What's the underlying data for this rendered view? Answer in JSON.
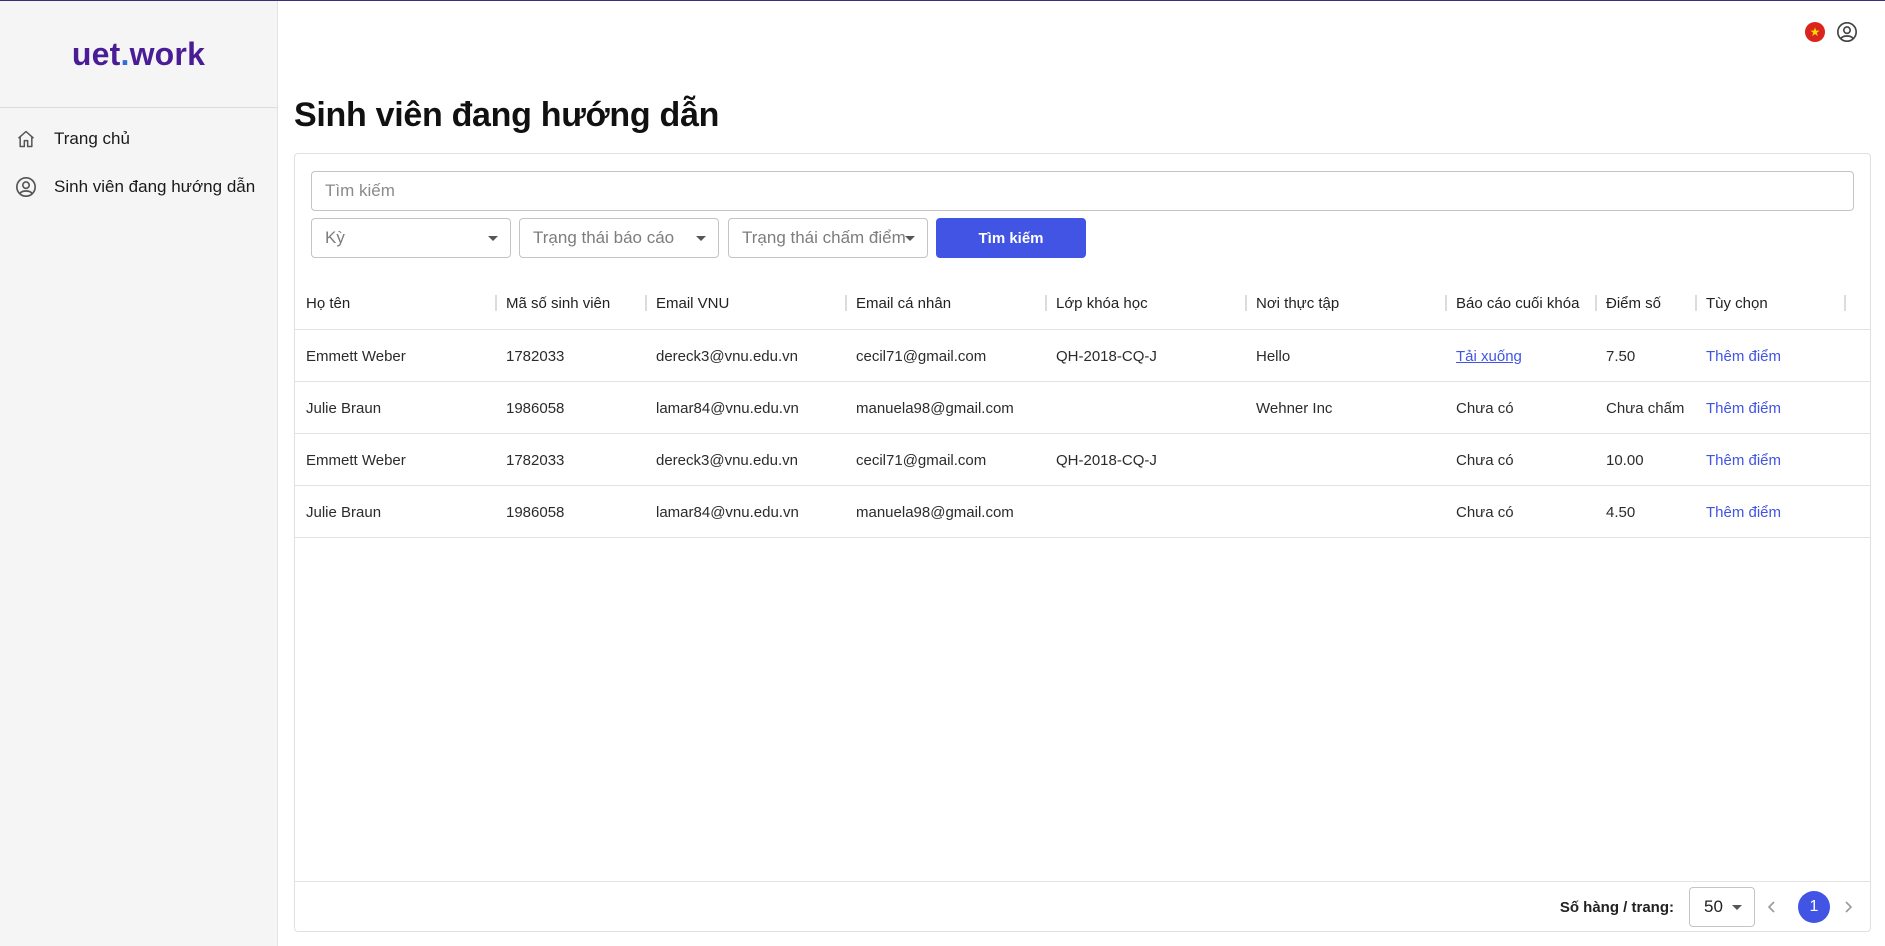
{
  "app": {
    "logo_left": "uet",
    "logo_dot": ".",
    "logo_right": "work"
  },
  "sidebar": {
    "items": [
      {
        "label": "Trang chủ",
        "icon": "home-icon"
      },
      {
        "label": "Sinh viên đang hướng dẫn",
        "icon": "user-circle-icon"
      }
    ]
  },
  "header": {
    "title": "Sinh viên đang hướng dẫn",
    "flag_icon": "vietnam-flag-icon",
    "account_icon": "user-circle-icon"
  },
  "filters": {
    "search_placeholder": "Tìm kiếm",
    "term_placeholder": "Kỳ",
    "report_status_placeholder": "Trạng thái báo cáo",
    "grading_status_placeholder": "Trạng thái chấm điểm",
    "search_button": "Tìm kiếm"
  },
  "table": {
    "columns": [
      "Họ tên",
      "Mã số sinh viên",
      "Email VNU",
      "Email cá nhân",
      "Lớp khóa học",
      "Nơi thực tập",
      "Báo cáo cuối khóa",
      "Điểm số",
      "Tùy chọn"
    ],
    "rows": [
      {
        "name": "Emmett Weber",
        "student_id": "1782033",
        "email_vnu": "dereck3@vnu.edu.vn",
        "email_personal": "cecil71@gmail.com",
        "class": "QH-2018-CQ-J",
        "internship": "Hello",
        "report": "Tải xuống",
        "report_is_link": true,
        "score": "7.50",
        "action": "Thêm điểm"
      },
      {
        "name": "Julie Braun",
        "student_id": "1986058",
        "email_vnu": "lamar84@vnu.edu.vn",
        "email_personal": "manuela98@gmail.com",
        "class": "",
        "internship": "Wehner Inc",
        "report": "Chưa có",
        "report_is_link": false,
        "score": "Chưa chấm",
        "action": "Thêm điểm"
      },
      {
        "name": "Emmett Weber",
        "student_id": "1782033",
        "email_vnu": "dereck3@vnu.edu.vn",
        "email_personal": "cecil71@gmail.com",
        "class": "QH-2018-CQ-J",
        "internship": "",
        "report": "Chưa có",
        "report_is_link": false,
        "score": "10.00",
        "action": "Thêm điểm"
      },
      {
        "name": "Julie Braun",
        "student_id": "1986058",
        "email_vnu": "lamar84@vnu.edu.vn",
        "email_personal": "manuela98@gmail.com",
        "class": "",
        "internship": "",
        "report": "Chưa có",
        "report_is_link": false,
        "score": "4.50",
        "action": "Thêm điểm"
      }
    ]
  },
  "pagination": {
    "rows_per_page_label": "Số hàng / trang:",
    "rows_per_page_value": "50",
    "current_page": "1"
  },
  "colors": {
    "accent": "#4154e4",
    "logo": "#4a1d96",
    "logo_dot": "#2f6fd6"
  }
}
